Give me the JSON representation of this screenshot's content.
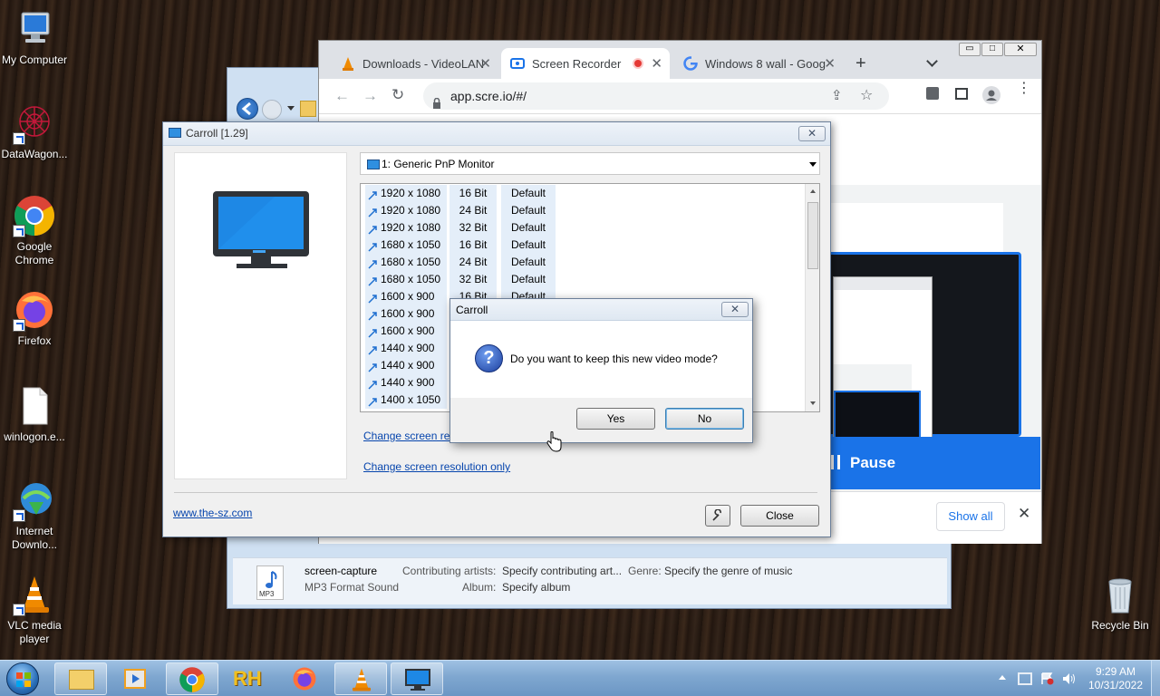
{
  "desktop": {
    "icons": [
      {
        "label": "My Computer"
      },
      {
        "label": "DataWagon..."
      },
      {
        "label": "Google Chrome"
      },
      {
        "label": "Firefox"
      },
      {
        "label": "winlogon.e..."
      },
      {
        "label": "Internet Downlo..."
      },
      {
        "label": "VLC media player"
      },
      {
        "label": "Recycle Bin"
      }
    ]
  },
  "chrome": {
    "tabs": [
      {
        "title": "Downloads - VideoLAN"
      },
      {
        "title": "Screen Recorder - "
      },
      {
        "title": "Windows 8 wall - Goog"
      }
    ],
    "url": "app.scre.io/#/",
    "page": {
      "pause_label": "Pause",
      "show_all_label": "Show all"
    }
  },
  "explorer": {
    "file_name": "screen-capture",
    "file_type": "MP3 Format Sound",
    "file_icon_text": "MP3",
    "contributing_artists_label": "Contributing artists:",
    "contributing_artists_value": "Specify contributing art...",
    "genre_label": "Genre:",
    "genre_value": "Specify the genre of music",
    "album_label": "Album:",
    "album_value": "Specify album"
  },
  "carroll": {
    "title": "Carroll [1.29]",
    "monitor_select": "1: Generic PnP Monitor",
    "modes": [
      {
        "res": "1920 x 1080",
        "bits": "16 Bit",
        "rate": "Default"
      },
      {
        "res": "1920 x 1080",
        "bits": "24 Bit",
        "rate": "Default"
      },
      {
        "res": "1920 x 1080",
        "bits": "32 Bit",
        "rate": "Default"
      },
      {
        "res": "1680 x 1050",
        "bits": "16 Bit",
        "rate": "Default"
      },
      {
        "res": "1680 x 1050",
        "bits": "24 Bit",
        "rate": "Default"
      },
      {
        "res": "1680 x 1050",
        "bits": "32 Bit",
        "rate": "Default"
      },
      {
        "res": "1600 x 900",
        "bits": "16 Bit",
        "rate": "Default"
      },
      {
        "res": "1600 x 900",
        "bits": "",
        "rate": ""
      },
      {
        "res": "1600 x 900",
        "bits": "",
        "rate": ""
      },
      {
        "res": "1440 x 900",
        "bits": "",
        "rate": ""
      },
      {
        "res": "1440 x 900",
        "bits": "",
        "rate": ""
      },
      {
        "res": "1440 x 900",
        "bits": "",
        "rate": ""
      },
      {
        "res": "1400 x 1050",
        "bits": "",
        "rate": ""
      }
    ],
    "link_change_user": "Change screen res",
    "link_change_only": "Change screen resolution only",
    "website_link": "www.the-sz.com",
    "close_label": "Close"
  },
  "dialog": {
    "title": "Carroll",
    "message": "Do you want to keep this new video mode?",
    "yes_label": "Yes",
    "no_label": "No"
  },
  "taskbar": {
    "time": "9:29 AM",
    "date": "10/31/2022",
    "rh_label": "RH"
  }
}
